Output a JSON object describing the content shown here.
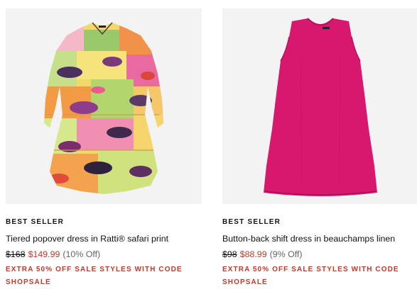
{
  "products": [
    {
      "badge": "BEST SELLER",
      "title": "Tiered popover dress in Ratti® safari print",
      "old_price": "$168",
      "sale_price": "$149.99",
      "percent_off": "(10% Off)",
      "promo_line1": "EXTRA 50% OFF SALE STYLES WITH CODE",
      "promo_line2": "SHOPSALE",
      "image_alt": "tiered-safari-print-dress-image"
    },
    {
      "badge": "BEST SELLER",
      "title": "Button-back shift dress in beauchamps linen",
      "old_price": "$98",
      "sale_price": "$88.99",
      "percent_off": "(9% Off)",
      "promo_line1": "EXTRA 50% OFF SALE STYLES WITH CODE",
      "promo_line2": "SHOPSALE",
      "image_alt": "pink-linen-shift-dress-image"
    }
  ],
  "colors": {
    "sale_red": "#c0392b",
    "image_bg": "#f3f3f3",
    "pink_dress": "#d8186e"
  }
}
